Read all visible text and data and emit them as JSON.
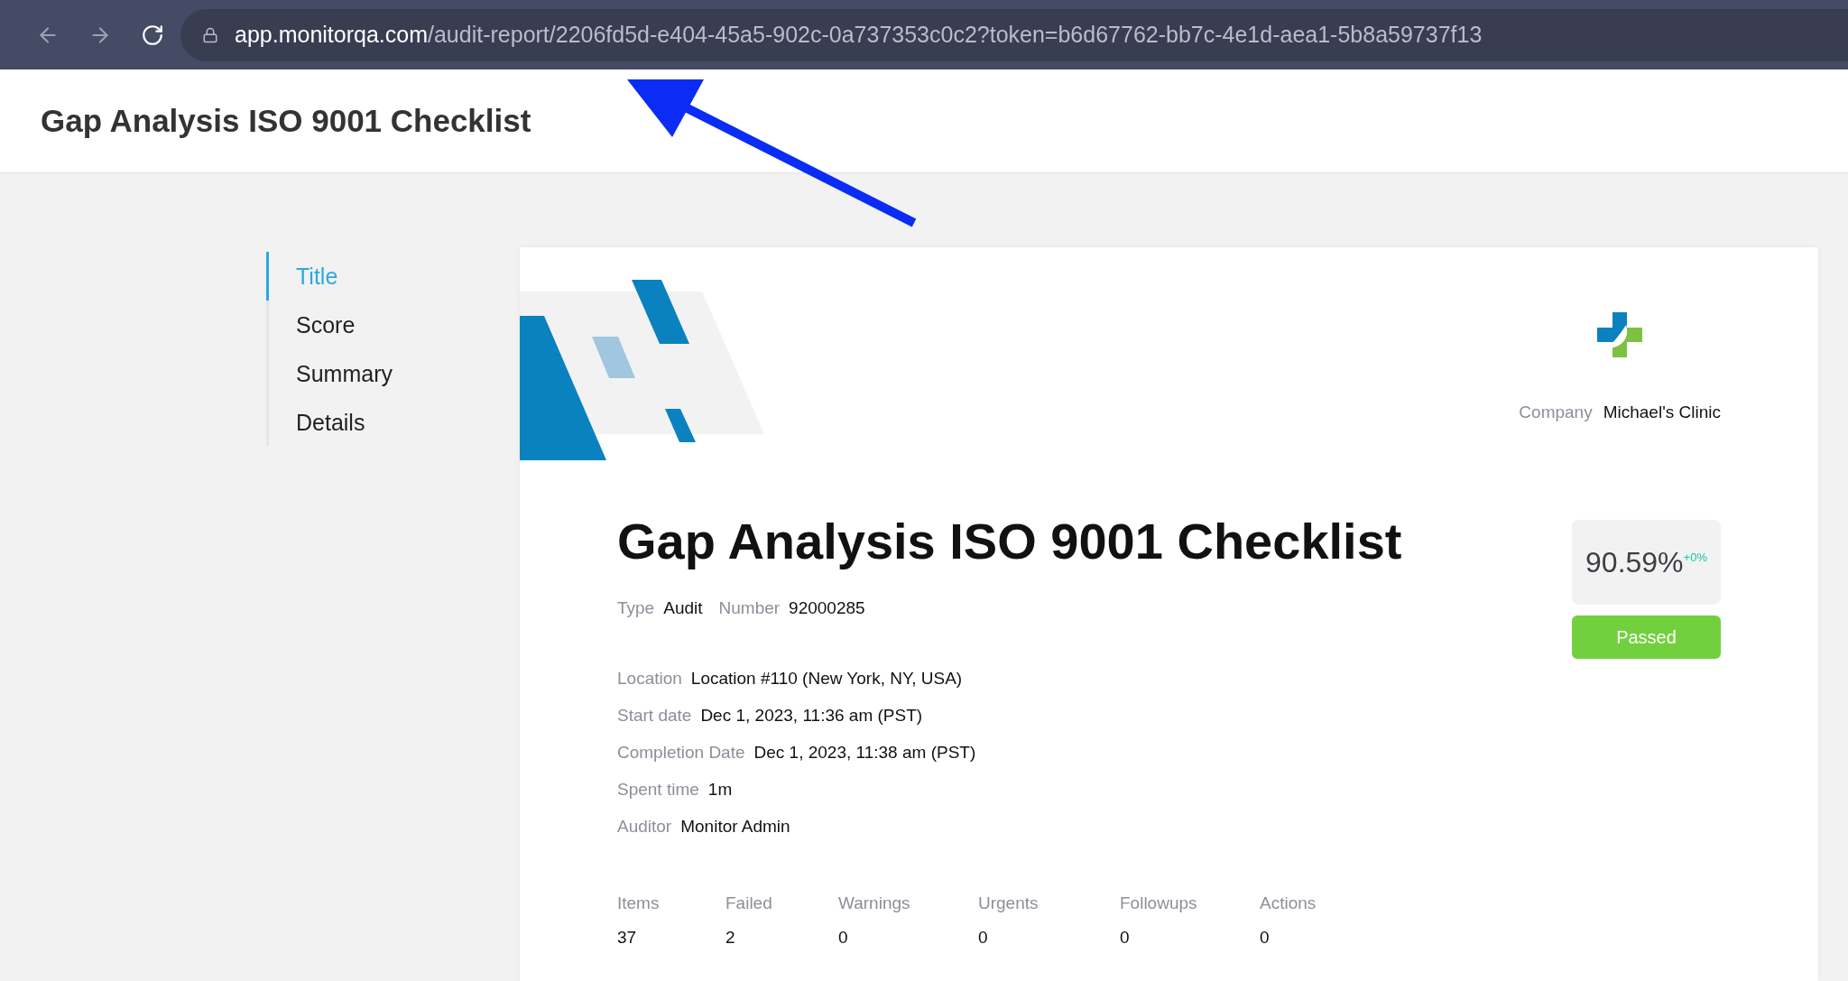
{
  "browser": {
    "url_host": "app.monitorqa.com",
    "url_path": "/audit-report/2206fd5d-e404-45a5-902c-0a737353c0c2?token=b6d67762-bb7c-4e1d-aea1-5b8a59737f13"
  },
  "header": {
    "title": "Gap Analysis ISO 9001 Checklist"
  },
  "nav": [
    {
      "label": "Title",
      "selected": true
    },
    {
      "label": "Score",
      "selected": false
    },
    {
      "label": "Summary",
      "selected": false
    },
    {
      "label": "Details",
      "selected": false
    }
  ],
  "company": {
    "label": "Company",
    "value": "Michael's Clinic"
  },
  "report": {
    "title": "Gap Analysis ISO 9001 Checklist",
    "type_label": "Type",
    "type_value": "Audit",
    "number_label": "Number",
    "number_value": "92000285",
    "fields": [
      {
        "label": "Location",
        "value": "Location #110 (New York, NY, USA)"
      },
      {
        "label": "Start date",
        "value": "Dec 1, 2023, 11:36 am (PST)"
      },
      {
        "label": "Completion Date",
        "value": "Dec 1, 2023, 11:38 am (PST)"
      },
      {
        "label": "Spent time",
        "value": "1m"
      },
      {
        "label": "Auditor",
        "value": "Monitor Admin"
      }
    ],
    "score": "90.59%",
    "score_change": "+0%",
    "result": "Passed",
    "stats": [
      {
        "label": "Items",
        "value": "37"
      },
      {
        "label": "Failed",
        "value": "2"
      },
      {
        "label": "Warnings",
        "value": "0"
      },
      {
        "label": "Urgents",
        "value": "0"
      },
      {
        "label": "Followups",
        "value": "0"
      },
      {
        "label": "Actions",
        "value": "0"
      }
    ]
  }
}
